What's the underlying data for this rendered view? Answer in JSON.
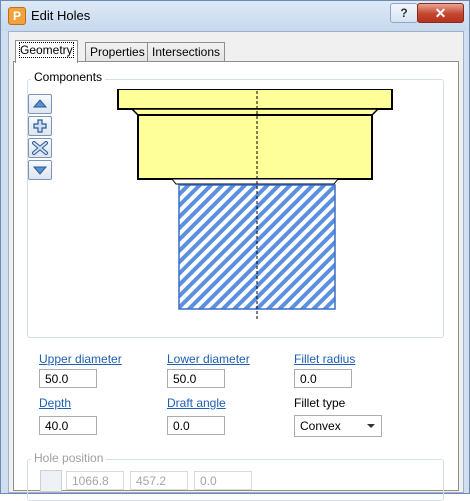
{
  "window": {
    "title": "Edit Holes",
    "help_label": "?",
    "close_label": "✕",
    "app_icon_letter": "P"
  },
  "tabs": [
    {
      "label": "Geometry",
      "active": true
    },
    {
      "label": "Properties",
      "active": false
    },
    {
      "label": "Intersections",
      "active": false
    }
  ],
  "components": {
    "group_label": "Components",
    "buttons": [
      "move-up-icon",
      "add-icon",
      "delete-icon",
      "move-down-icon"
    ],
    "colors": {
      "component_fill": "#ffff99",
      "hatch": "#5b8fe0",
      "hatch_bg": "#ffffff"
    }
  },
  "fields": {
    "upper_diameter": {
      "label": "Upper diameter",
      "value": "50.0"
    },
    "lower_diameter": {
      "label": "Lower diameter",
      "value": "50.0"
    },
    "fillet_radius": {
      "label": "Fillet radius",
      "value": "0.0"
    },
    "depth": {
      "label": "Depth",
      "value": "40.0"
    },
    "draft_angle": {
      "label": "Draft angle",
      "value": "0.0"
    },
    "fillet_type": {
      "label": "Fillet type",
      "value": "Convex"
    }
  },
  "hole_position": {
    "group_label": "Hole position",
    "values": [
      "1066.8",
      "457.2",
      "0.0"
    ]
  }
}
